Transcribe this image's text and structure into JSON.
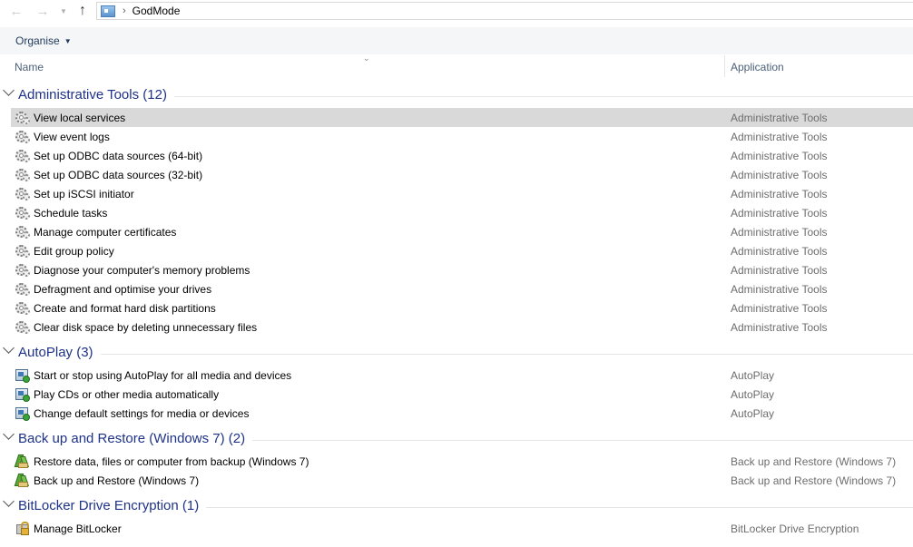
{
  "address_bar": {
    "back_icon": "back-arrow-icon",
    "forward_icon": "forward-arrow-icon",
    "recent_icon": "chevron-down-icon",
    "up_icon": "up-arrow-icon",
    "location_icon": "control-panel-icon",
    "separator": "›",
    "crumb": "GodMode"
  },
  "command_bar": {
    "organise_label": "Organise"
  },
  "columns": {
    "name": "Name",
    "application": "Application"
  },
  "groups": [
    {
      "title": "Administrative Tools (12)",
      "icon": "gear-icon",
      "items": [
        {
          "label": "View local services",
          "app": "Administrative Tools",
          "selected": true
        },
        {
          "label": "View event logs",
          "app": "Administrative Tools"
        },
        {
          "label": "Set up ODBC data sources (64-bit)",
          "app": "Administrative Tools"
        },
        {
          "label": "Set up ODBC data sources (32-bit)",
          "app": "Administrative Tools"
        },
        {
          "label": "Set up iSCSI initiator",
          "app": "Administrative Tools"
        },
        {
          "label": "Schedule tasks",
          "app": "Administrative Tools"
        },
        {
          "label": "Manage computer certificates",
          "app": "Administrative Tools"
        },
        {
          "label": "Edit group policy",
          "app": "Administrative Tools"
        },
        {
          "label": "Diagnose your computer's memory problems",
          "app": "Administrative Tools"
        },
        {
          "label": "Defragment and optimise your drives",
          "app": "Administrative Tools"
        },
        {
          "label": "Create and format hard disk partitions",
          "app": "Administrative Tools"
        },
        {
          "label": "Clear disk space by deleting unnecessary files",
          "app": "Administrative Tools"
        }
      ]
    },
    {
      "title": "AutoPlay (3)",
      "icon": "autoplay-icon",
      "items": [
        {
          "label": "Start or stop using AutoPlay for all media and devices",
          "app": "AutoPlay"
        },
        {
          "label": "Play CDs or other media automatically",
          "app": "AutoPlay"
        },
        {
          "label": "Change default settings for media or devices",
          "app": "AutoPlay"
        }
      ]
    },
    {
      "title": "Back up and Restore (Windows 7) (2)",
      "icon": "backup-restore-icon",
      "items": [
        {
          "label": "Restore data, files or computer from backup (Windows 7)",
          "app": "Back up and Restore (Windows 7)"
        },
        {
          "label": "Back up and Restore (Windows 7)",
          "app": "Back up and Restore (Windows 7)"
        }
      ]
    },
    {
      "title": "BitLocker Drive Encryption (1)",
      "icon": "bitlocker-icon",
      "items": [
        {
          "label": "Manage BitLocker",
          "app": "BitLocker Drive Encryption"
        }
      ]
    }
  ]
}
